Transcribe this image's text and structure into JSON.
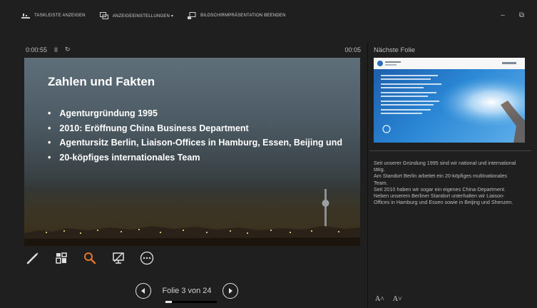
{
  "toolbar": {
    "show_taskbar": "TASKLEISTE ANZEIGEN",
    "display_settings": "ANZEIGEEINSTELLUNGEN ▾",
    "end_slideshow": "BILDSCHIRMPRÄSENTATION BEENDEN"
  },
  "window": {
    "minimize": "–",
    "restore": "⧉"
  },
  "timer": {
    "elapsed": "0:00:55",
    "pause": "II",
    "reset": "↻",
    "clock": "00:05"
  },
  "slide": {
    "title": "Zahlen und Fakten",
    "bullets": [
      "Agenturgründung 1995",
      "2010: Eröffnung China Business Department",
      "Agentursitz Berlin, Liaison-Offices in Hamburg, Essen, Beijing und",
      "20-köpfiges internationales Team"
    ]
  },
  "tools": {
    "pen": "pen-icon",
    "slides": "see-all-slides-icon",
    "zoom": "zoom-icon",
    "screen": "black-screen-icon",
    "more": "more-options-icon"
  },
  "navigation": {
    "counter": "Folie 3 von 24",
    "progress": 0.125
  },
  "next_slide": {
    "label": "Nächste Folie"
  },
  "notes": [
    "Seit unserer Gründung 1995 sind wir national und international tätig.",
    "Am Standort Berlin arbeitet ein 20-köpfiges multinationales Team.",
    "Seit 2010 haben wir sogar ein eigenes China-Department. Neben unserem Berliner Standort unterhalten wir Liaison-Offices in Hamburg und Essen sowie in Beijing und Shenzen."
  ],
  "font_controls": {
    "increase": "A˄",
    "decrease": "A˅"
  },
  "colors": {
    "background": "#1f1f1f",
    "accent_zoom": "#e8742a",
    "text": "#d8d8d8"
  }
}
